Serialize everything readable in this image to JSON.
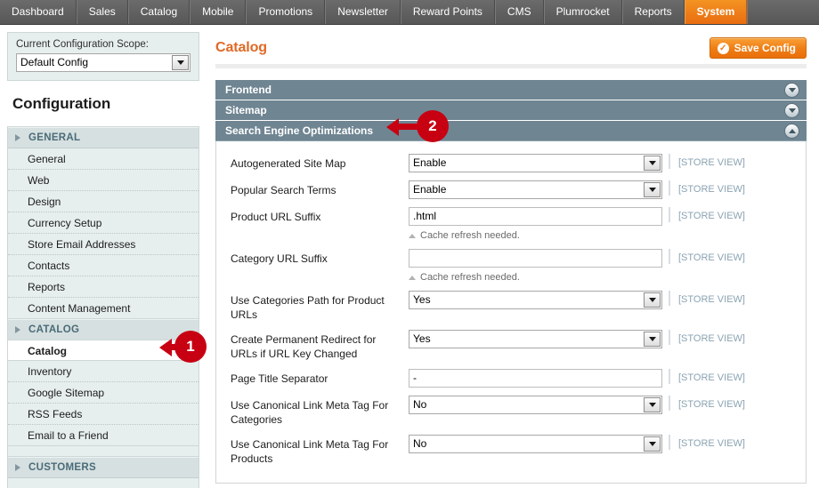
{
  "topnav": {
    "items": [
      {
        "label": "Dashboard",
        "active": false
      },
      {
        "label": "Sales",
        "active": false
      },
      {
        "label": "Catalog",
        "active": false
      },
      {
        "label": "Mobile",
        "active": false
      },
      {
        "label": "Promotions",
        "active": false
      },
      {
        "label": "Newsletter",
        "active": false
      },
      {
        "label": "Reward Points",
        "active": false
      },
      {
        "label": "CMS",
        "active": false
      },
      {
        "label": "Plumrocket",
        "active": false
      },
      {
        "label": "Reports",
        "active": false
      },
      {
        "label": "System",
        "active": true
      }
    ]
  },
  "sidebar": {
    "scope_label": "Current Configuration Scope:",
    "scope_value": "Default Config",
    "config_title": "Configuration",
    "groups": [
      {
        "label": "GENERAL",
        "items": [
          {
            "label": "General",
            "active": false
          },
          {
            "label": "Web",
            "active": false
          },
          {
            "label": "Design",
            "active": false
          },
          {
            "label": "Currency Setup",
            "active": false
          },
          {
            "label": "Store Email Addresses",
            "active": false
          },
          {
            "label": "Contacts",
            "active": false
          },
          {
            "label": "Reports",
            "active": false
          },
          {
            "label": "Content Management",
            "active": false
          }
        ]
      },
      {
        "label": "CATALOG",
        "items": [
          {
            "label": "Catalog",
            "active": true
          },
          {
            "label": "Inventory",
            "active": false
          },
          {
            "label": "Google Sitemap",
            "active": false
          },
          {
            "label": "RSS Feeds",
            "active": false
          },
          {
            "label": "Email to a Friend",
            "active": false
          }
        ]
      },
      {
        "label": "CUSTOMERS",
        "items": []
      }
    ]
  },
  "content": {
    "page_title": "Catalog",
    "save_label": "Save Config",
    "save_icon": "check-circle-icon",
    "sections": [
      {
        "label": "Frontend",
        "state": "collapsed",
        "icon": "chevron-down-icon"
      },
      {
        "label": "Sitemap",
        "state": "collapsed",
        "icon": "chevron-down-icon"
      },
      {
        "label": "Search Engine Optimizations",
        "state": "expanded",
        "icon": "chevron-up-icon"
      }
    ],
    "scope_note": "[STORE VIEW]",
    "cache_hint": "Cache refresh needed.",
    "fields": [
      {
        "label": "Autogenerated Site Map",
        "type": "select",
        "value": "Enable",
        "hint": null
      },
      {
        "label": "Popular Search Terms",
        "type": "select",
        "value": "Enable",
        "hint": null
      },
      {
        "label": "Product URL Suffix",
        "type": "text",
        "value": ".html",
        "hint": "Cache refresh needed."
      },
      {
        "label": "Category URL Suffix",
        "type": "text",
        "value": "",
        "hint": "Cache refresh needed."
      },
      {
        "label": "Use Categories Path for Product URLs",
        "type": "select",
        "value": "Yes",
        "hint": null
      },
      {
        "label": "Create Permanent Redirect for URLs if URL Key Changed",
        "type": "select",
        "value": "Yes",
        "hint": null
      },
      {
        "label": "Page Title Separator",
        "type": "text",
        "value": "-",
        "hint": null
      },
      {
        "label": "Use Canonical Link Meta Tag For Categories",
        "type": "select",
        "value": "No",
        "hint": null
      },
      {
        "label": "Use Canonical Link Meta Tag For Products",
        "type": "select",
        "value": "No",
        "hint": null
      }
    ]
  },
  "annotations": {
    "color": "#c70012",
    "markers": [
      {
        "number": "1",
        "target": "sidebar-item-catalog"
      },
      {
        "number": "2",
        "target": "section-search-engine-optimizations"
      }
    ]
  }
}
